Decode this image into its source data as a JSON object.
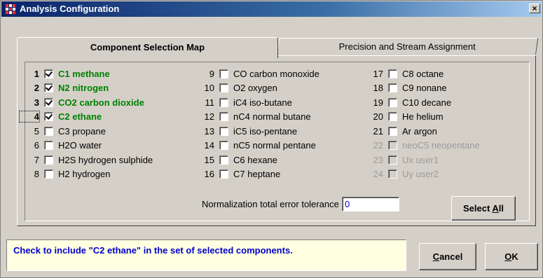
{
  "window": {
    "title": "Analysis Configuration",
    "close_label": "×"
  },
  "tabs": [
    {
      "label": "Component Selection Map",
      "active": true
    },
    {
      "label": "Precision and Stream Assignment",
      "active": false
    }
  ],
  "components": [
    {
      "num": "1",
      "label": "C1 methane",
      "checked": true,
      "selected": true
    },
    {
      "num": "2",
      "label": "N2 nitrogen",
      "checked": true,
      "selected": true
    },
    {
      "num": "3",
      "label": "CO2 carbon dioxide",
      "checked": true,
      "selected": true
    },
    {
      "num": "4",
      "label": "C2 ethane",
      "checked": true,
      "selected": true,
      "focused": true
    },
    {
      "num": "5",
      "label": "C3 propane",
      "checked": false
    },
    {
      "num": "6",
      "label": "H2O water",
      "checked": false
    },
    {
      "num": "7",
      "label": "H2S hydrogen sulphide",
      "checked": false
    },
    {
      "num": "8",
      "label": "H2 hydrogen",
      "checked": false
    },
    {
      "num": "9",
      "label": "CO carbon monoxide",
      "checked": false
    },
    {
      "num": "10",
      "label": "O2 oxygen",
      "checked": false
    },
    {
      "num": "11",
      "label": "iC4 iso-butane",
      "checked": false
    },
    {
      "num": "12",
      "label": "nC4 normal butane",
      "checked": false
    },
    {
      "num": "13",
      "label": "iC5 iso-pentane",
      "checked": false
    },
    {
      "num": "14",
      "label": "nC5 normal pentane",
      "checked": false
    },
    {
      "num": "15",
      "label": "C6 hexane",
      "checked": false
    },
    {
      "num": "16",
      "label": "C7 heptane",
      "checked": false
    },
    {
      "num": "17",
      "label": "C8 octane",
      "checked": false
    },
    {
      "num": "18",
      "label": "C9 nonane",
      "checked": false
    },
    {
      "num": "19",
      "label": "C10 decane",
      "checked": false
    },
    {
      "num": "20",
      "label": "He helium",
      "checked": false
    },
    {
      "num": "21",
      "label": "Ar argon",
      "checked": false
    },
    {
      "num": "22",
      "label": "neoC5 neopentane",
      "checked": false,
      "disabled": true
    },
    {
      "num": "23",
      "label": "Ux user1",
      "checked": false,
      "disabled": true
    },
    {
      "num": "24",
      "label": "Uy user2",
      "checked": false,
      "disabled": true
    }
  ],
  "tolerance": {
    "label": "Normalization total error tolerance",
    "value": "0"
  },
  "buttons": {
    "select_all": {
      "pre": "Select ",
      "accel": "A",
      "post": "ll"
    },
    "cancel": {
      "pre": "",
      "accel": "C",
      "post": "ancel"
    },
    "ok": {
      "pre": "",
      "accel": "O",
      "post": "K"
    }
  },
  "hint": "Check to include \"C2 ethane\" in the set of selected components.",
  "colors": {
    "selected_text": "#008000",
    "hint_text": "#0000cc",
    "hint_bg": "#ffffe1",
    "title_bar": "#0a246a"
  }
}
